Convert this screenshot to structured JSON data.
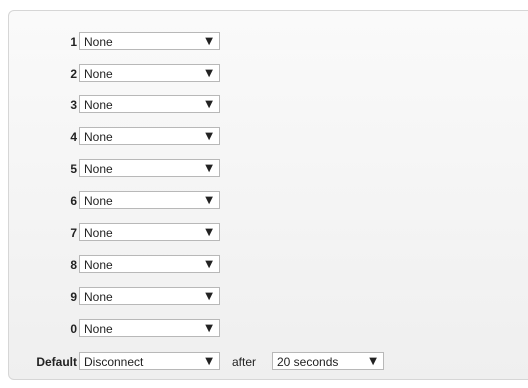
{
  "rows": [
    {
      "key": "1",
      "value": "None"
    },
    {
      "key": "2",
      "value": "None"
    },
    {
      "key": "3",
      "value": "None"
    },
    {
      "key": "4",
      "value": "None"
    },
    {
      "key": "5",
      "value": "None"
    },
    {
      "key": "6",
      "value": "None"
    },
    {
      "key": "7",
      "value": "None"
    },
    {
      "key": "8",
      "value": "None"
    },
    {
      "key": "9",
      "value": "None"
    },
    {
      "key": "0",
      "value": "None"
    }
  ],
  "default_row": {
    "label": "Default",
    "action": "Disconnect",
    "after_label": "after",
    "timeout": "20 seconds"
  },
  "icons": {
    "dropdown_arrow": "▼"
  }
}
